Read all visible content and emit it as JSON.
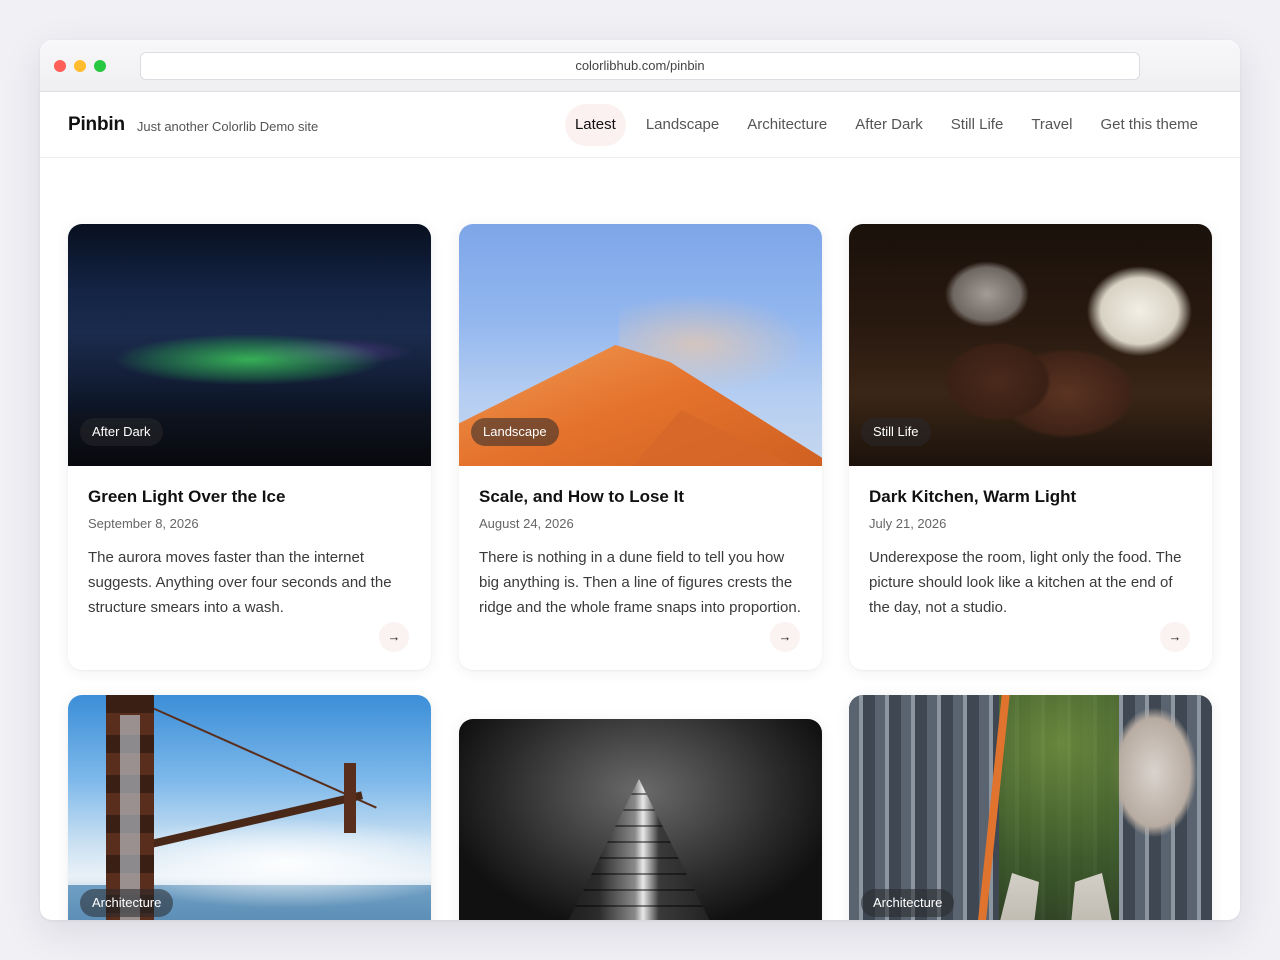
{
  "browser": {
    "url": "colorlibhub.com/pinbin"
  },
  "site": {
    "brand": "Pinbin",
    "tagline": "Just another Colorlib Demo site"
  },
  "nav": {
    "items": [
      {
        "label": "Latest",
        "active": true
      },
      {
        "label": "Landscape",
        "active": false
      },
      {
        "label": "Architecture",
        "active": false
      },
      {
        "label": "After Dark",
        "active": false
      },
      {
        "label": "Still Life",
        "active": false
      },
      {
        "label": "Travel",
        "active": false
      },
      {
        "label": "Get this theme",
        "active": false
      }
    ]
  },
  "posts": [
    {
      "category": "After Dark",
      "title": "Green Light Over the Ice",
      "date": "September 8, 2026",
      "excerpt": "The aurora moves faster than the internet suggests. Anything over four seconds and the structure smears into a wash.",
      "image_icon": "aurora-photo"
    },
    {
      "category": "Landscape",
      "title": "Scale, and How to Lose It",
      "date": "August 24, 2026",
      "excerpt": "There is nothing in a dune field to tell you how big anything is. Then a line of figures crests the ridge and the whole frame snaps into proportion.",
      "image_icon": "dune-photo"
    },
    {
      "category": "Still Life",
      "title": "Dark Kitchen, Warm Light",
      "date": "July 21, 2026",
      "excerpt": "Underexpose the room, light only the food. The picture should look like a kitchen at the end of the day, not a studio.",
      "image_icon": "cookies-photo"
    },
    {
      "category": "Architecture",
      "image_icon": "bridge-photo"
    },
    {
      "category": "",
      "image_icon": "skyscraper-photo"
    },
    {
      "category": "Architecture",
      "image_icon": "city-rooftop-photo"
    }
  ],
  "read_more_icon": "arrow-right-icon",
  "colors": {
    "page_bg": "#f1f0f5",
    "active_nav_bg": "#fbf1f1",
    "badge_bg": "rgba(40,40,44,0.55)"
  }
}
